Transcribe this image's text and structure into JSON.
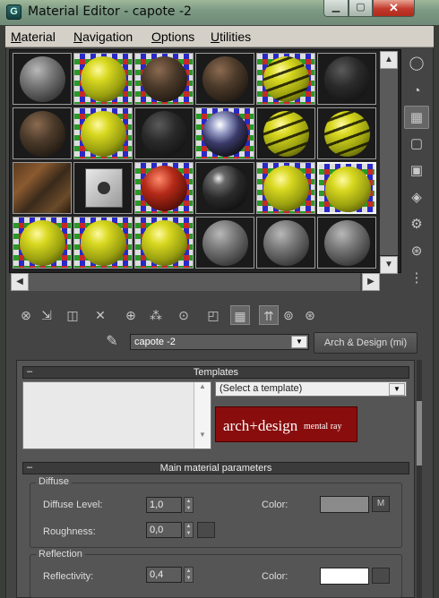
{
  "window": {
    "title": "Material Editor - capote -2",
    "app_icon_glyph": "G"
  },
  "menu": [
    {
      "label": "Material",
      "u": "M",
      "rest": "aterial"
    },
    {
      "label": "Navigation",
      "u": "N",
      "rest": "avigation"
    },
    {
      "label": "Options",
      "u": "O",
      "rest": "ptions"
    },
    {
      "label": "Utilities",
      "u": "U",
      "rest": "tilities"
    }
  ],
  "slots": [
    [
      "grey",
      "yellow-checker",
      "rust-checker",
      "rust",
      "yellow-stripe-checker",
      "black-tex"
    ],
    [
      "rust",
      "yellow-checker",
      "black-tex",
      "chrome-checker",
      "yellow-stripe",
      "yellow-stripe"
    ],
    [
      "rust-flat",
      "cube",
      "red-checker",
      "black-shiny",
      "yellow-checker",
      "yellow-checker-active"
    ],
    [
      "yellow-checker",
      "yellow-checker",
      "yellow-checker",
      "grey",
      "grey",
      "grey"
    ]
  ],
  "side_toolbar_icons": [
    "sample-type-sphere-icon",
    "backlight-icon",
    "background-checker-icon",
    "sample-uv-tiling-icon",
    "video-color-check-icon",
    "make-preview-icon",
    "options-icon",
    "select-by-material-icon",
    "material-map-navigator-icon"
  ],
  "bottom_toolbar_icons": [
    "get-material-icon",
    "put-to-scene-icon",
    "assign-to-selection-icon",
    "reset-map-icon",
    "make-unique-icon",
    "put-to-library-icon",
    "material-id-channel-icon",
    "show-map-in-viewport-icon",
    "show-end-result-icon",
    "go-to-parent-icon",
    "go-to-sibling-icon"
  ],
  "material": {
    "name": "capote -2",
    "type": "Arch & Design (mi)"
  },
  "templates": {
    "title": "Templates",
    "select_placeholder": "(Select a template)",
    "banner_main": "arch+design",
    "banner_sub": "mental ray"
  },
  "main_params": {
    "title": "Main material parameters",
    "diffuse": {
      "label": "Diffuse",
      "level_label": "Diffuse Level:",
      "level": "1,0",
      "roughness_label": "Roughness:",
      "roughness": "0,0",
      "color_label": "Color:",
      "color_hex": "#8a8a8a",
      "map_button": "M"
    },
    "reflection": {
      "label": "Reflection",
      "reflectivity_label": "Reflectivity:",
      "reflectivity": "0,4",
      "color_label": "Color:",
      "color_hex": "#ffffff"
    }
  }
}
